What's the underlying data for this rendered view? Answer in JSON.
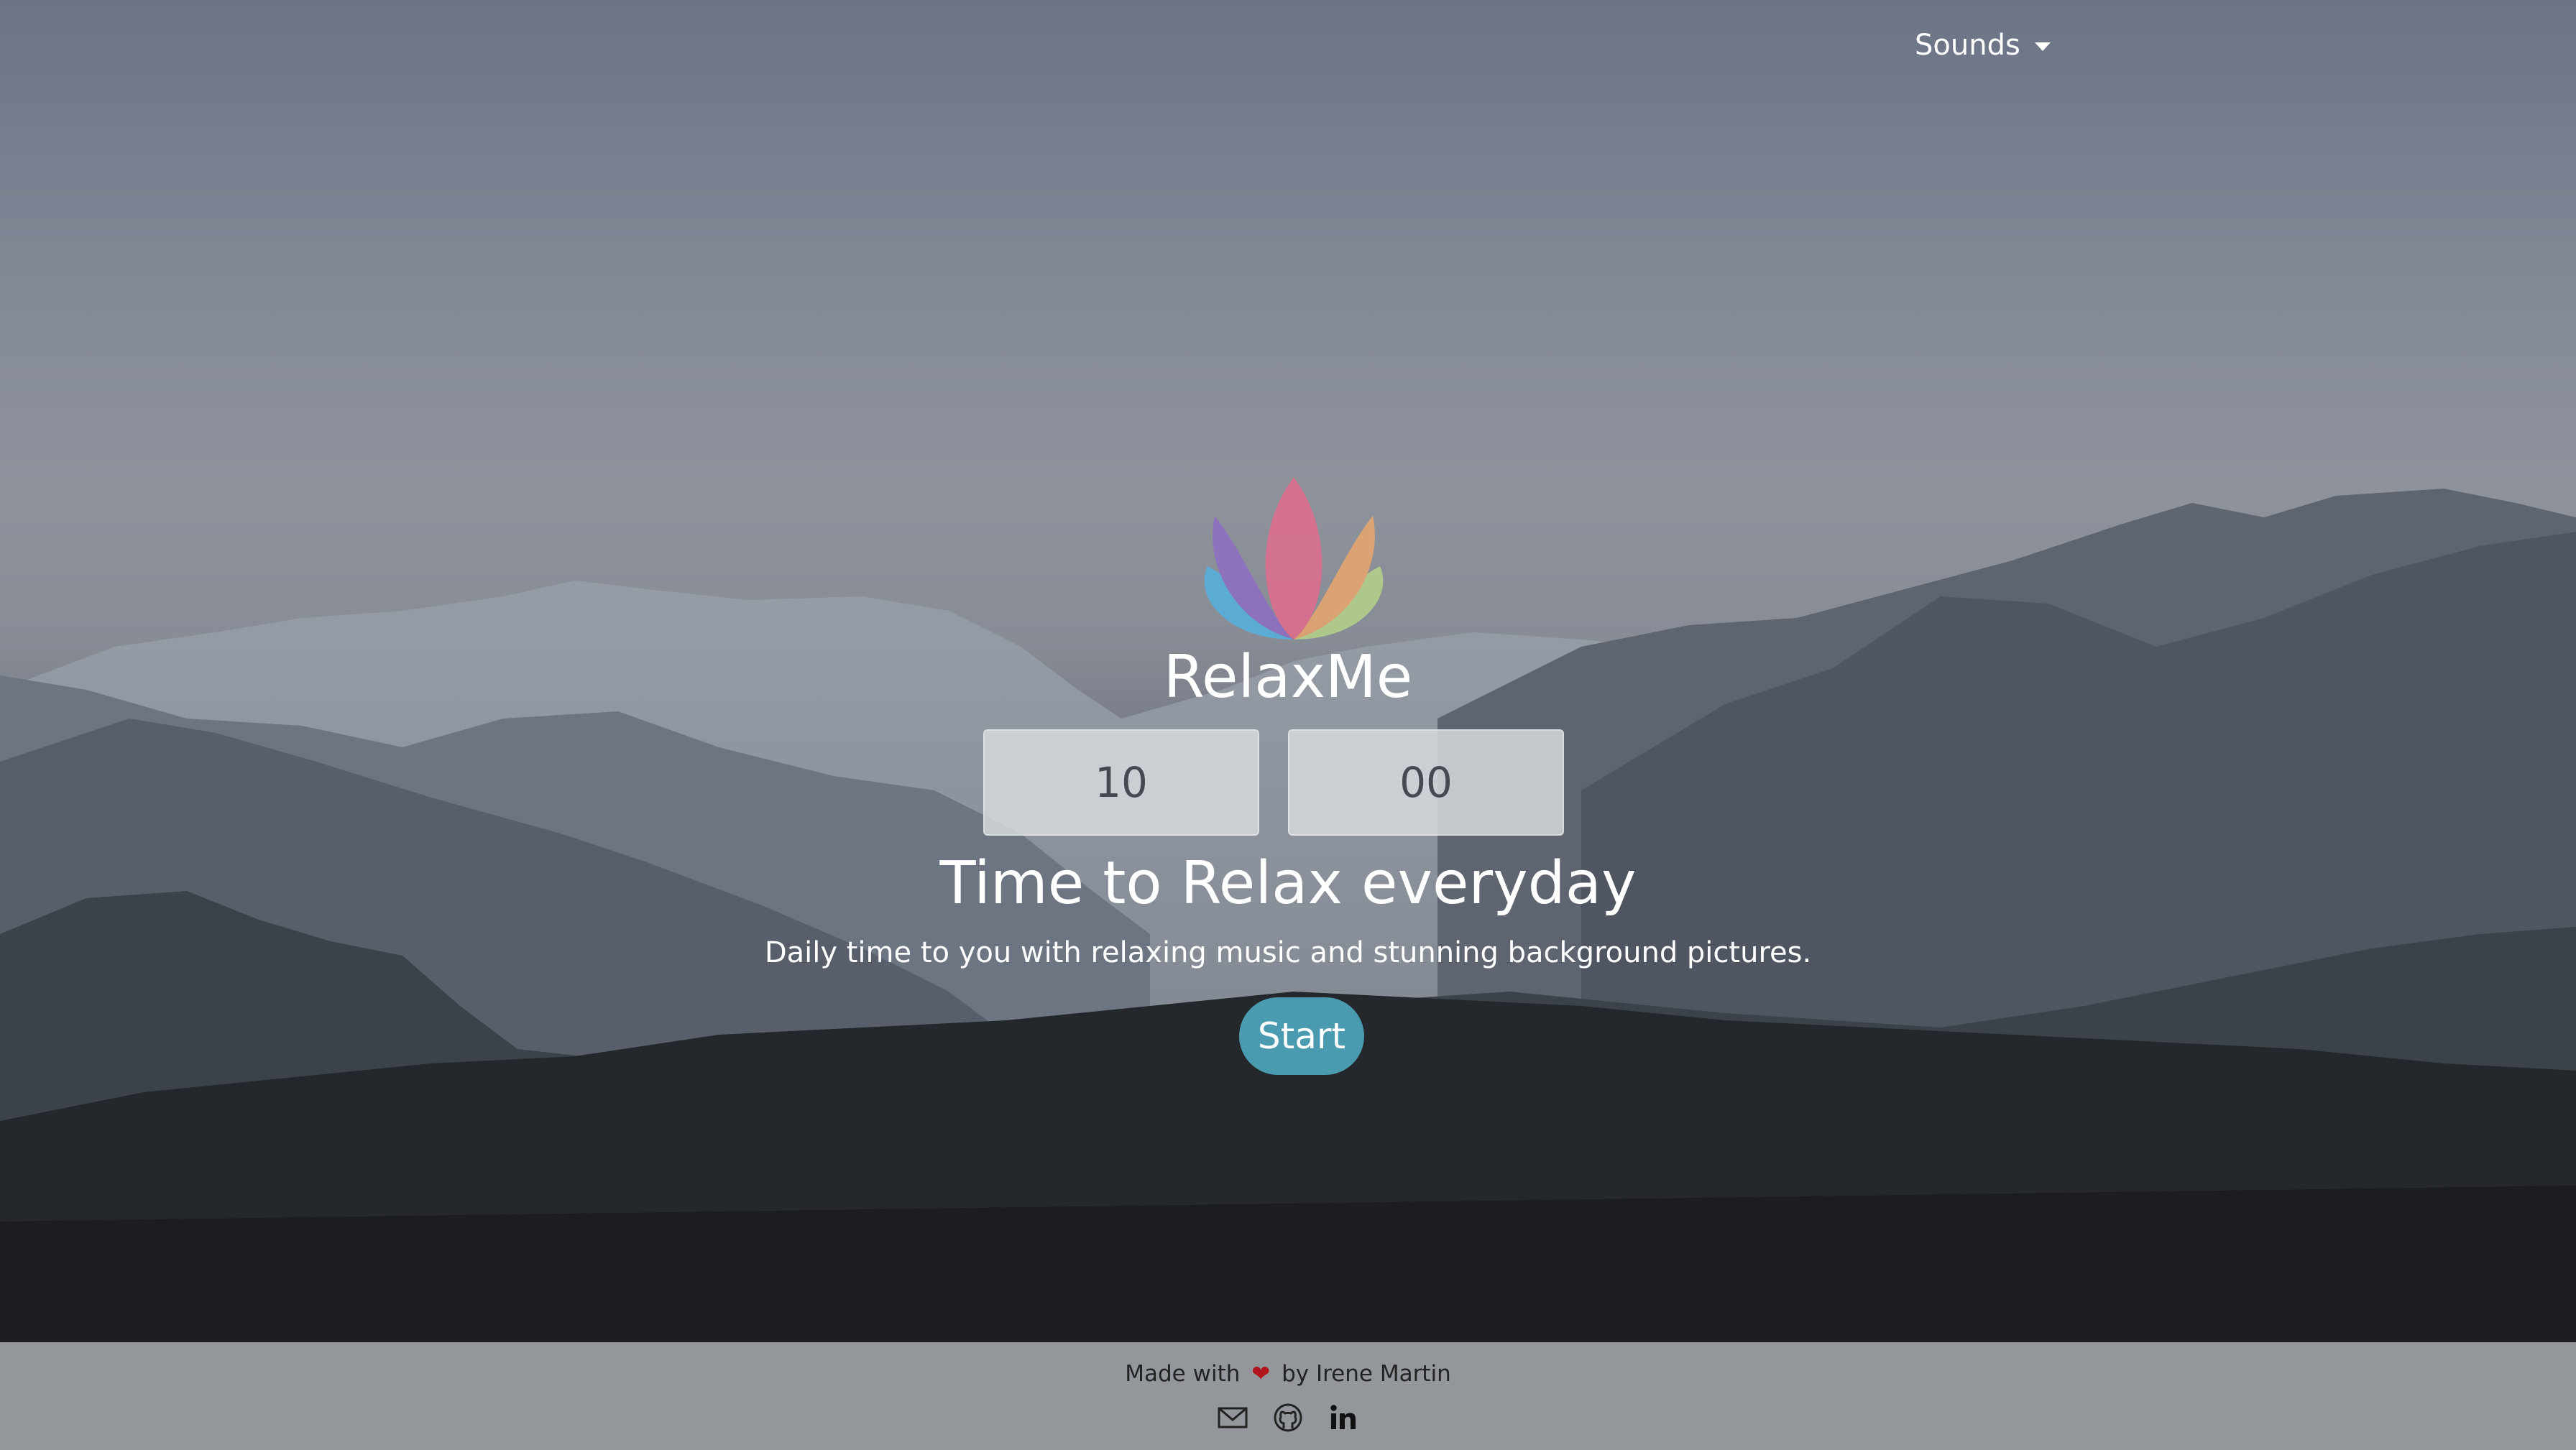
{
  "nav": {
    "sounds_label": "Sounds"
  },
  "brand": {
    "name": "RelaxMe"
  },
  "timer": {
    "minutes": "10",
    "seconds": "00"
  },
  "hero": {
    "headline": "Time to Relax everyday",
    "subline": "Daily time to you with relaxing music and stunning background pictures.",
    "start_label": "Start"
  },
  "footer": {
    "made_with": "Made with",
    "heart": "❤",
    "author": "by Irene Martin",
    "icons": [
      "envelope-icon",
      "github-icon",
      "linkedin-icon"
    ]
  },
  "colors": {
    "accent": "#4a9bb0",
    "footer_bg": "#a8aaaf",
    "heart": "#b0151b"
  }
}
